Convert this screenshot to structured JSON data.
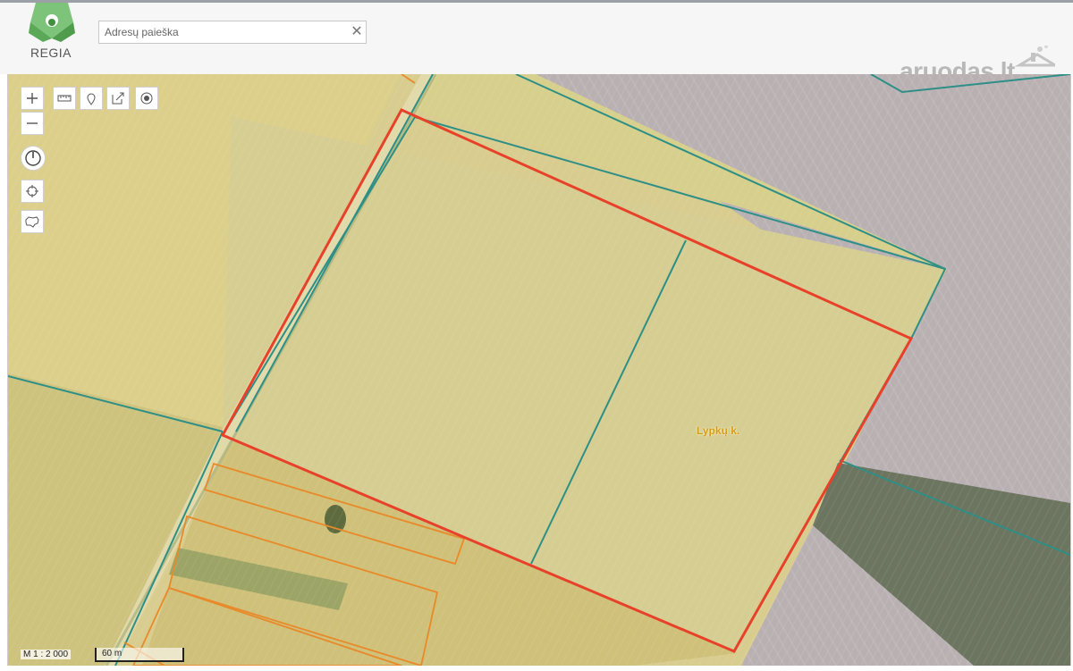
{
  "app": {
    "logo_text": "REGIA",
    "logo_color": "#6db56a"
  },
  "search": {
    "placeholder": "Adresų paieška",
    "value": "",
    "clear_icon": "close-icon"
  },
  "watermark": {
    "text": "aruodas.lt",
    "color": "#b8b8b8"
  },
  "map": {
    "place_label": "Lypkų k.",
    "scale_text": "M 1 : 2 000",
    "scale_bar_label": "60 m",
    "colors": {
      "selected_parcel": "#e8412a",
      "parcel_boundary": "#2e8f86",
      "other_parcel": "#e88a2a",
      "field_yellow": "#d9cf8e",
      "field_grey": "#b7b0b0"
    }
  },
  "toolbar": {
    "zoom_in_icon": "plus-icon",
    "zoom_out_icon": "minus-icon",
    "measure_icon": "ruler-icon",
    "marker_icon": "pin-icon",
    "edit_icon": "edit-icon",
    "record_icon": "target-dot-icon",
    "rotate_icon": "compass-icon",
    "locate_icon": "crosshair-icon",
    "region_icon": "lithuania-outline-icon"
  }
}
